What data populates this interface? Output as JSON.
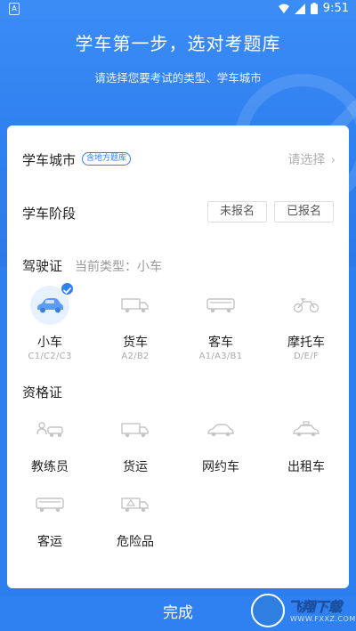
{
  "statusbar": {
    "time": "9:51",
    "left_badge": "A"
  },
  "header": {
    "title": "学车第一步，选对考题库",
    "subtitle": "请选择您要考试的类型、学车城市"
  },
  "city": {
    "label": "学车城市",
    "tag": "含地方题库",
    "choose": "请选择"
  },
  "stage": {
    "label": "学车阶段",
    "options": [
      "未报名",
      "已报名"
    ]
  },
  "license": {
    "title": "驾驶证",
    "current": "当前类型：小车",
    "items": [
      {
        "name": "小车",
        "sub": "C1/C2/C3",
        "icon": "car-icon",
        "selected": true
      },
      {
        "name": "货车",
        "sub": "A2/B2",
        "icon": "truck-icon",
        "selected": false
      },
      {
        "name": "客车",
        "sub": "A1/A3/B1",
        "icon": "bus-icon",
        "selected": false
      },
      {
        "name": "摩托车",
        "sub": "D/E/F",
        "icon": "motorcycle-icon",
        "selected": false
      }
    ]
  },
  "qualification": {
    "title": "资格证",
    "items": [
      {
        "name": "教练员",
        "icon": "coach-car-icon"
      },
      {
        "name": "货运",
        "icon": "freight-truck-icon"
      },
      {
        "name": "网约车",
        "icon": "ride-hailing-car-icon"
      },
      {
        "name": "出租车",
        "icon": "taxi-icon"
      },
      {
        "name": "客运",
        "icon": "passenger-bus-icon"
      },
      {
        "name": "危险品",
        "icon": "hazmat-truck-icon"
      }
    ]
  },
  "footer": {
    "done_label": "完成"
  },
  "watermark": {
    "text": "飞翔下载",
    "url": "WWW.FXXZ.COM"
  },
  "colors": {
    "primary": "#2f80f0",
    "muted": "#aaaaaa"
  }
}
